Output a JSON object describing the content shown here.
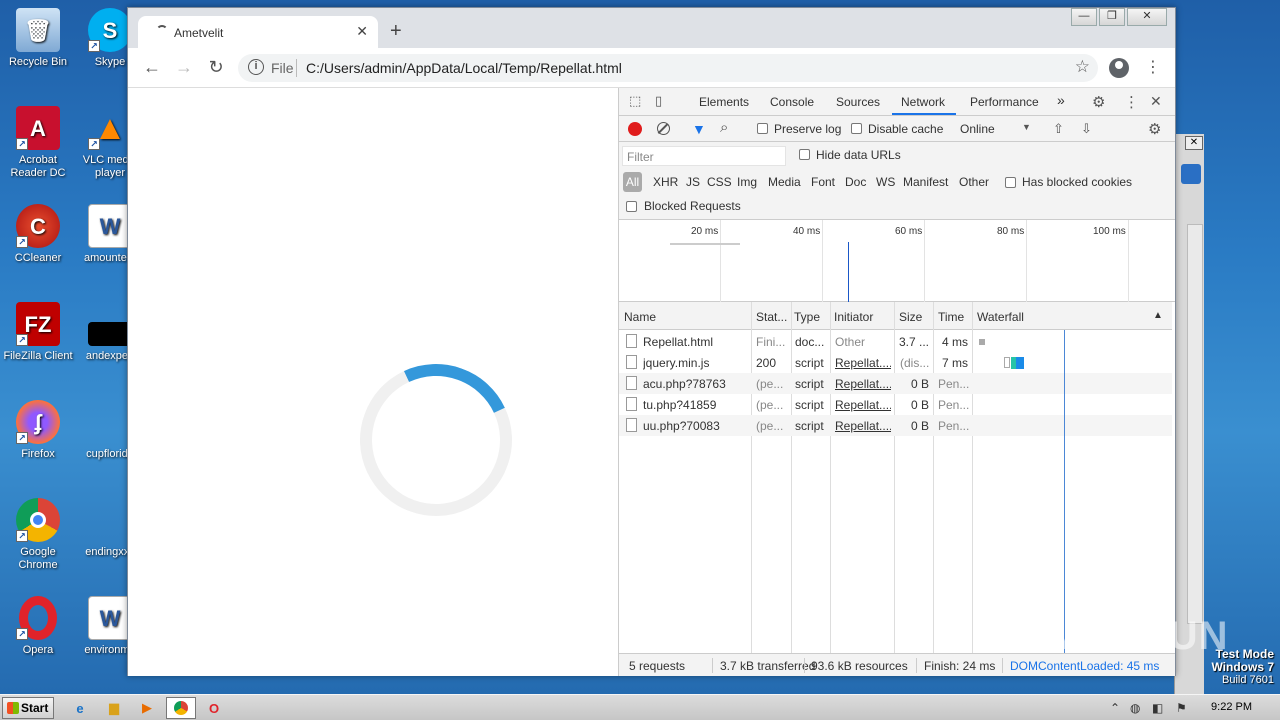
{
  "desktop": {
    "icons": [
      {
        "label": "Recycle Bin",
        "icon": "recycle-bin-icon"
      },
      {
        "label": "Acrobat Reader DC",
        "icon": "acrobat-icon"
      },
      {
        "label": "CCleaner",
        "icon": "ccleaner-icon"
      },
      {
        "label": "FileZilla Client",
        "icon": "filezilla-icon"
      },
      {
        "label": "Firefox",
        "icon": "firefox-icon"
      },
      {
        "label": "Google Chrome",
        "icon": "chrome-icon"
      },
      {
        "label": "Opera",
        "icon": "opera-icon"
      },
      {
        "label": "Skype",
        "icon": "skype-icon"
      },
      {
        "label": "VLC media player",
        "icon": "vlc-icon"
      },
      {
        "label": "amountent",
        "icon": "word-doc-icon"
      },
      {
        "label": "andexperi",
        "icon": "black-file-icon"
      },
      {
        "label": "cupflorida",
        "icon": "blank-file-icon"
      },
      {
        "label": "endingxxx",
        "icon": "blank-file-icon"
      },
      {
        "label": "environme",
        "icon": "word-doc-icon"
      }
    ]
  },
  "browser": {
    "tab_title": "Ametvelit",
    "tab_close": "✕",
    "new_tab": "+",
    "address": {
      "scheme": "File",
      "url": "C:/Users/admin/AppData/Local/Temp/Repellat.html"
    },
    "window_buttons": [
      "—",
      "❐",
      "✕"
    ]
  },
  "devtools": {
    "tabs": [
      "Elements",
      "Console",
      "Sources",
      "Network",
      "Performance"
    ],
    "active_tab": "Network",
    "more_tabs": "»",
    "toolbar": {
      "preserve_log": "Preserve log",
      "disable_cache": "Disable cache",
      "throttling": "Online"
    },
    "filter": {
      "placeholder": "Filter",
      "hide_data_urls": "Hide data URLs",
      "types": [
        "All",
        "XHR",
        "JS",
        "CSS",
        "Img",
        "Media",
        "Font",
        "Doc",
        "WS",
        "Manifest",
        "Other"
      ],
      "active_type": "All",
      "has_blocked_cookies": "Has blocked cookies",
      "blocked_requests": "Blocked Requests"
    },
    "overview_ticks": [
      "20 ms",
      "40 ms",
      "60 ms",
      "80 ms",
      "100 ms"
    ],
    "columns": [
      "Name",
      "Stat...",
      "Type",
      "Initiator",
      "Size",
      "Time",
      "Waterfall"
    ],
    "rows": [
      {
        "name": "Repellat.html",
        "status": "Fini...",
        "type": "doc...",
        "initiator": "Other",
        "size": "3.7 ...",
        "time": "4 ms"
      },
      {
        "name": "jquery.min.js",
        "status": "200",
        "type": "script",
        "initiator": "Repellat....",
        "size": "(dis...",
        "time": "7 ms"
      },
      {
        "name": "acu.php?78763",
        "status": "(pe...",
        "type": "script",
        "initiator": "Repellat....",
        "size": "0 B",
        "time": "Pen..."
      },
      {
        "name": "tu.php?41859",
        "status": "(pe...",
        "type": "script",
        "initiator": "Repellat....",
        "size": "0 B",
        "time": "Pen..."
      },
      {
        "name": "uu.php?70083",
        "status": "(pe...",
        "type": "script",
        "initiator": "Repellat....",
        "size": "0 B",
        "time": "Pen..."
      }
    ],
    "status": {
      "requests": "5 requests",
      "transferred": "3.7 kB transferred",
      "resources": "93.6 kB resources",
      "finish": "Finish: 24 ms",
      "dom_loaded": "DOMContentLoaded: 45 ms"
    }
  },
  "taskbar": {
    "start": "Start",
    "clock": "9:22 PM"
  },
  "watermark": {
    "line1": "Test Mode",
    "line2": "Windows 7",
    "line3": "Build 7601",
    "brand": "ANY RUN"
  }
}
